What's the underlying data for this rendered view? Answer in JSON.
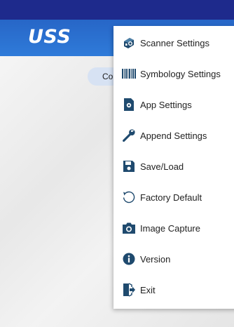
{
  "app": {
    "logo_text": "USS",
    "chip_text": "Co"
  },
  "menu": {
    "items": [
      {
        "id": "scanner",
        "label": "Scanner Settings",
        "icon": "scanner-icon"
      },
      {
        "id": "symbology",
        "label": "Symbology Settings",
        "icon": "barcode-icon"
      },
      {
        "id": "app",
        "label": "App Settings",
        "icon": "app-settings-icon"
      },
      {
        "id": "append",
        "label": "Append Settings",
        "icon": "wrench-icon"
      },
      {
        "id": "saveload",
        "label": "Save/Load",
        "icon": "save-icon"
      },
      {
        "id": "factory",
        "label": "Factory Default",
        "icon": "reset-icon"
      },
      {
        "id": "image",
        "label": "Image Capture",
        "icon": "camera-icon"
      },
      {
        "id": "version",
        "label": "Version",
        "icon": "info-icon"
      },
      {
        "id": "exit",
        "label": "Exit",
        "icon": "exit-icon"
      }
    ]
  },
  "colors": {
    "status_bar": "#1e2a8c",
    "app_bar": "#2f7bd9",
    "icon_dark": "#1f4a6e"
  }
}
